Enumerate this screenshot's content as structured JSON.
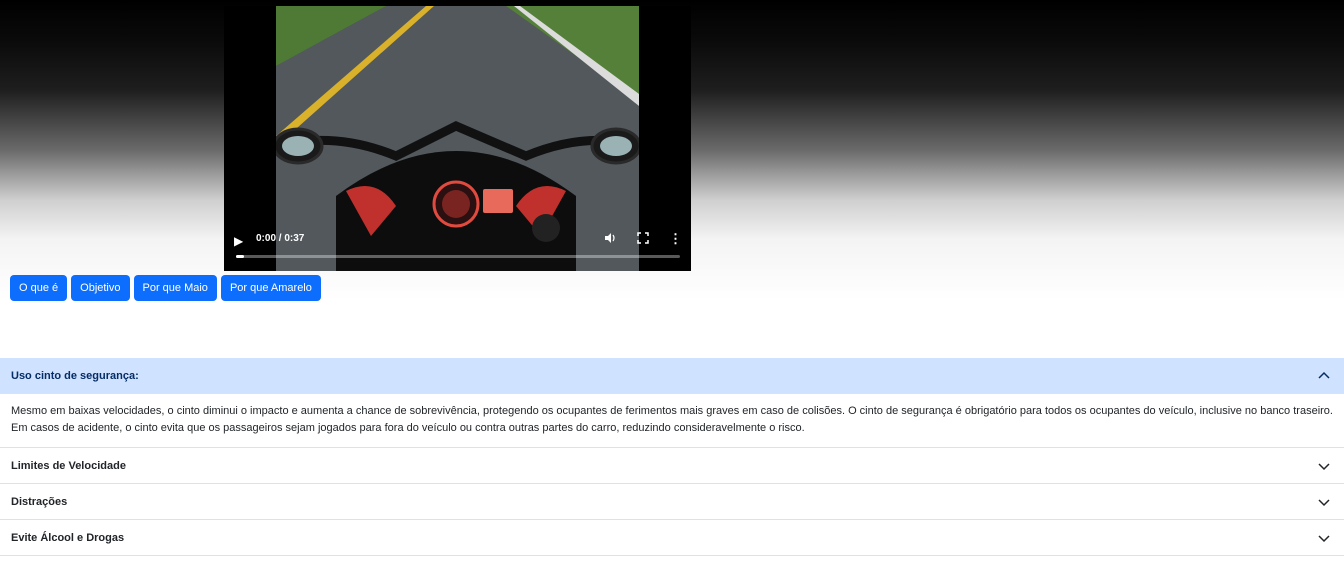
{
  "video": {
    "time": "0:00 / 0:37",
    "progress": 0.0,
    "icons": [
      "play-icon",
      "volume-icon",
      "fullscreen-icon",
      "more-options-icon"
    ]
  },
  "buttons": [
    "O que é",
    "Objetivo",
    "Por que Maio",
    "Por que Amarelo"
  ],
  "accordion": {
    "items": [
      {
        "title": "Uso cinto de segurança:",
        "open": true,
        "body": "Mesmo em baixas velocidades, o cinto diminui o impacto e aumenta a chance de sobrevivência, protegendo os ocupantes de ferimentos mais graves em caso de colisões. O cinto de segurança é obrigatório para todos os ocupantes do veículo, inclusive no banco traseiro. Em casos de acidente, o cinto evita que os passageiros sejam jogados para fora do veículo ou contra outras partes do carro, reduzindo consideravelmente o risco."
      },
      {
        "title": "Limites de Velocidade",
        "open": false
      },
      {
        "title": "Distrações",
        "open": false
      },
      {
        "title": "Evite Álcool e Drogas",
        "open": false
      }
    ]
  },
  "colors": {
    "primary": "#0d6efd",
    "accordion_open_bg": "#cfe2ff",
    "accordion_open_text": "#052c65"
  }
}
